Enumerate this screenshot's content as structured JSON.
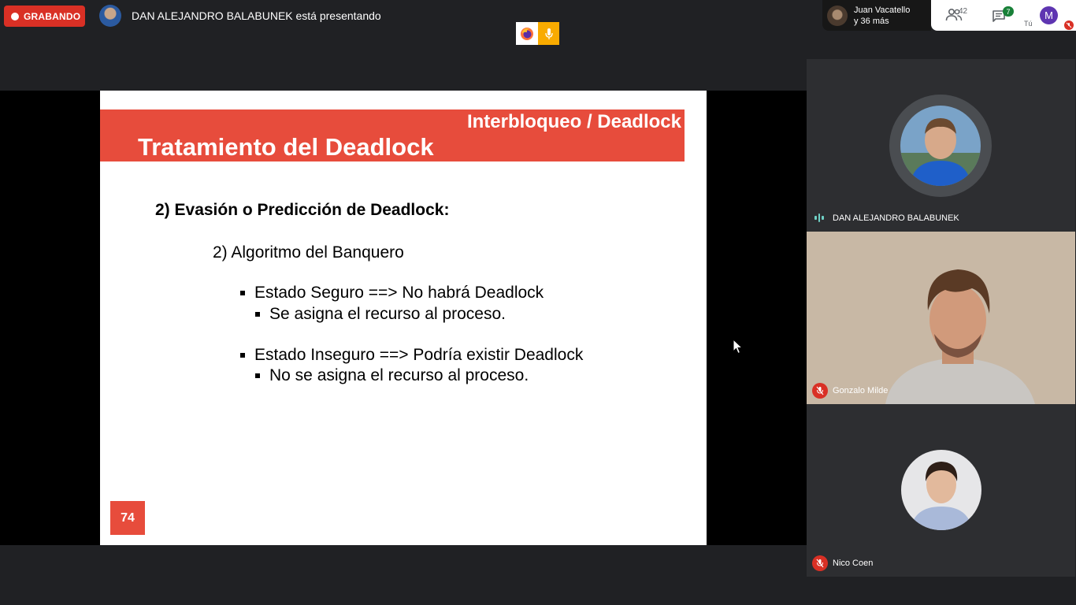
{
  "recording": {
    "label": "GRABANDO"
  },
  "presenter": {
    "status_text": "DAN ALEJANDRO BALABUNEK está presentando"
  },
  "people": {
    "line1": "Juan Vacatello",
    "line2": "y 36 más"
  },
  "controls": {
    "participants_count": "42",
    "chat_count": "7",
    "you_label": "Tú",
    "you_initial": "M"
  },
  "slide": {
    "subtitle": "Interbloqueo / Deadlock",
    "title": "Tratamiento del Deadlock",
    "heading": "2) Evasión o Predicción de Deadlock:",
    "subheading": "2) Algoritmo del Banquero",
    "bullets": [
      {
        "text": "Estado Seguro ==> No habrá Deadlock",
        "sub": "Se asigna el recurso al proceso."
      },
      {
        "text": "Estado Inseguro ==> Podría existir Deadlock",
        "sub": "No se asigna el recurso al proceso."
      }
    ],
    "page_number": "74"
  },
  "participants": [
    {
      "name": "DAN ALEJANDRO BALABUNEK",
      "speaking": true
    },
    {
      "name": "Gonzalo Milde",
      "muted": true
    },
    {
      "name": "Nico Coen",
      "muted": true
    }
  ],
  "colors": {
    "accent_red": "#d93025",
    "slide_red": "#e74c3c",
    "chat_green": "#188038",
    "speaking_teal": "#6fd0c5"
  }
}
